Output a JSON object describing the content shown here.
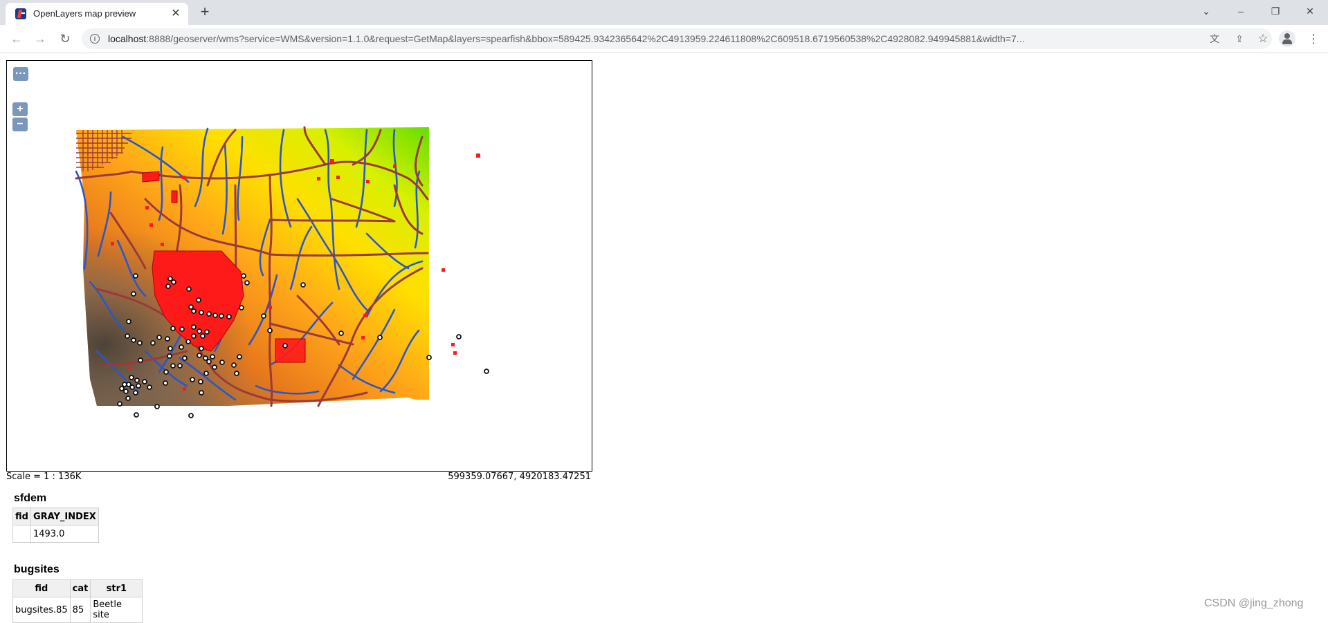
{
  "browser": {
    "tab_title": "OpenLayers map preview",
    "tab_close_icon": "close-icon",
    "new_tab_icon": "plus-icon",
    "window_controls": {
      "tab_search": "⌄",
      "minimize": "–",
      "restore": "❐",
      "close": "✕"
    },
    "nav": {
      "back": "←",
      "forward": "→",
      "reload": "↻"
    },
    "url_host": "localhost",
    "url_rest": ":8888/geoserver/wms?service=WMS&version=1.1.0&request=GetMap&layers=spearfish&bbox=589425.9342365642%2C4913959.224611808%2C609518.6719560538%2C4928082.949945881&width=7...",
    "url_icons": {
      "translate": "文",
      "share": "⇪",
      "bookmark": "☆"
    },
    "menu": "⋮"
  },
  "map": {
    "toolbar_toggle": "···",
    "zoom_in": "+",
    "zoom_out": "−",
    "scale": "Scale = 1 : 136K",
    "coordinates": "599359.07667, 4920183.47251",
    "layer": "spearfish",
    "colors": {
      "dem_low": "#5e5448",
      "dem_mid": "#ff9a1e",
      "dem_high": "#ffe600",
      "dem_top": "#7fe000",
      "roads": "#9a3a3a",
      "streams": "#2a57c8",
      "restricted": "#ff1a1a",
      "bugsites": "#ffffff"
    }
  },
  "feature_info": [
    {
      "layer": "sfdem",
      "columns": [
        "fid",
        "GRAY_INDEX"
      ],
      "rows": [
        [
          "",
          "1493.0"
        ]
      ]
    },
    {
      "layer": "bugsites",
      "columns": [
        "fid",
        "cat",
        "str1"
      ],
      "rows": [
        [
          "bugsites.85",
          "85",
          "Beetle site"
        ]
      ]
    }
  ],
  "watermark": "CSDN @jing_zhong"
}
